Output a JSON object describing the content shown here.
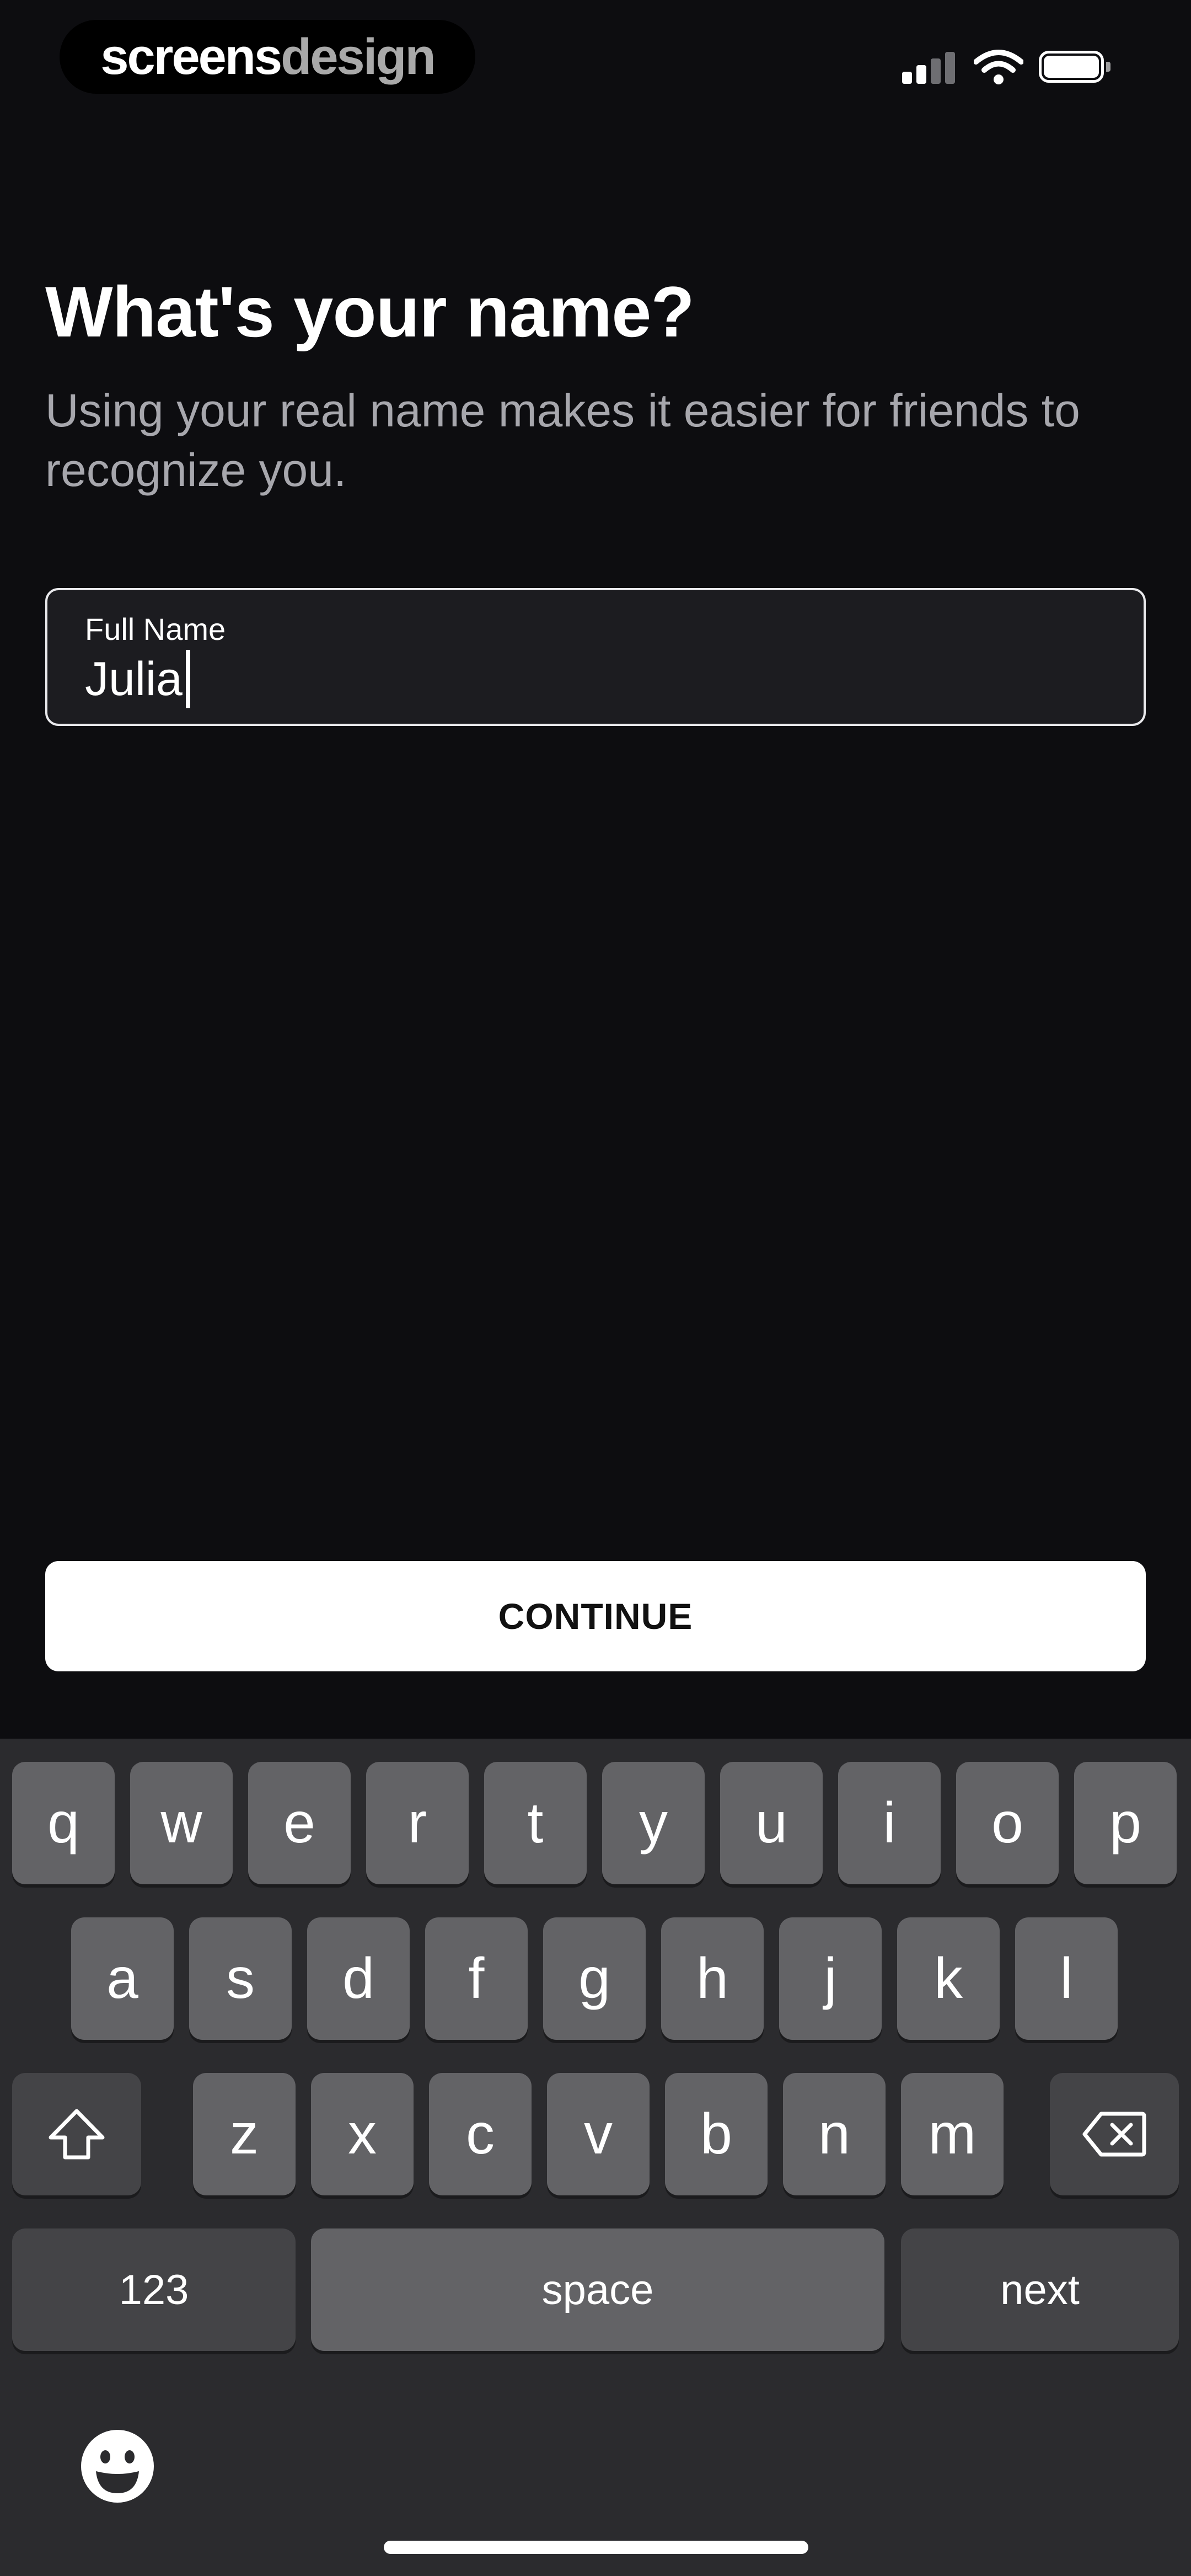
{
  "brand": {
    "part1": "screens",
    "part2": "design"
  },
  "status_bar": {
    "icons": [
      "cellular-signal-icon",
      "wifi-icon",
      "battery-icon"
    ]
  },
  "title": "What's your name?",
  "subtitle": "Using your real name makes it easier for friends to recognize you.",
  "name_field": {
    "label": "Full Name",
    "value": "Julia"
  },
  "continue_label": "CONTINUE",
  "keyboard": {
    "row1": [
      "q",
      "w",
      "e",
      "r",
      "t",
      "y",
      "u",
      "i",
      "o",
      "p"
    ],
    "row2": [
      "a",
      "s",
      "d",
      "f",
      "g",
      "h",
      "j",
      "k",
      "l"
    ],
    "row3": [
      "z",
      "x",
      "c",
      "v",
      "b",
      "n",
      "m"
    ],
    "numbers_label": "123",
    "space_label": "space",
    "next_label": "next",
    "icons": [
      "shift-icon",
      "backspace-icon",
      "emoji-icon"
    ]
  },
  "colors": {
    "background": "#0d0d10",
    "key": "#636366",
    "key_dark": "#444447",
    "keyboard_bg": "#2b2b2e"
  }
}
